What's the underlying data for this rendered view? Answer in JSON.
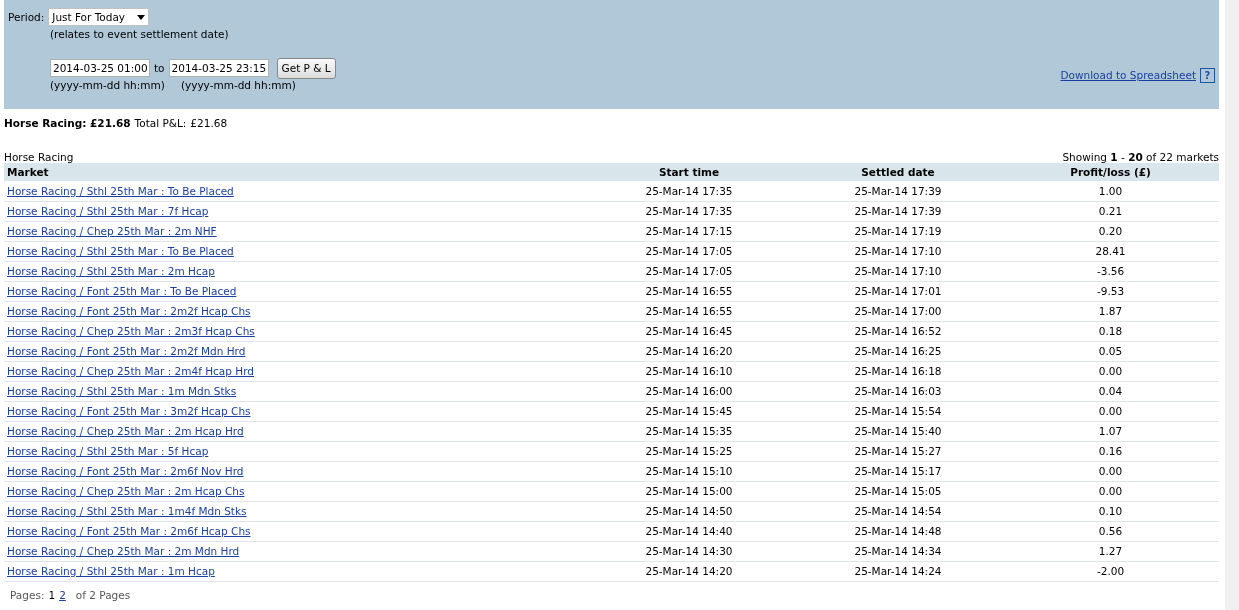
{
  "filter": {
    "period_label": "Period:",
    "period_value": "Just For Today",
    "period_note": "(relates to event settlement date)",
    "from_value": "2014-03-25 01:00",
    "to_label": "to",
    "to_value": "2014-03-25 23:15",
    "from_hint": "(yyyy-mm-dd hh:mm)",
    "to_hint": "(yyyy-mm-dd hh:mm)",
    "button": "Get P & L",
    "download_link": "Download to Spreadsheet",
    "help": "?"
  },
  "summary": {
    "sport_total": "**Horse Racing: £21.68**",
    "total_label": "Total P&L:",
    "total_value": "£21.68"
  },
  "table": {
    "caption": "Horse Racing",
    "showing": "Showing **1** - **20** of 22 markets",
    "columns": [
      "Market",
      "Start time",
      "Settled date",
      "Profit/loss (£)"
    ],
    "rows": [
      [
        "Horse Racing / Sthl 25th Mar : To Be Placed",
        "25-Mar-14 17:35",
        "25-Mar-14 17:39",
        "1.00"
      ],
      [
        "Horse Racing / Sthl 25th Mar : 7f Hcap",
        "25-Mar-14 17:35",
        "25-Mar-14 17:39",
        "0.21"
      ],
      [
        "Horse Racing / Chep 25th Mar : 2m NHF",
        "25-Mar-14 17:15",
        "25-Mar-14 17:19",
        "0.20"
      ],
      [
        "Horse Racing / Sthl 25th Mar : To Be Placed",
        "25-Mar-14 17:05",
        "25-Mar-14 17:10",
        "28.41"
      ],
      [
        "Horse Racing / Sthl 25th Mar : 2m Hcap",
        "25-Mar-14 17:05",
        "25-Mar-14 17:10",
        "-3.56"
      ],
      [
        "Horse Racing / Font 25th Mar : To Be Placed",
        "25-Mar-14 16:55",
        "25-Mar-14 17:01",
        "-9.53"
      ],
      [
        "Horse Racing / Font 25th Mar : 2m2f Hcap Chs",
        "25-Mar-14 16:55",
        "25-Mar-14 17:00",
        "1.87"
      ],
      [
        "Horse Racing / Chep 25th Mar : 2m3f Hcap Chs",
        "25-Mar-14 16:45",
        "25-Mar-14 16:52",
        "0.18"
      ],
      [
        "Horse Racing / Font 25th Mar : 2m2f Mdn Hrd",
        "25-Mar-14 16:20",
        "25-Mar-14 16:25",
        "0.05"
      ],
      [
        "Horse Racing / Chep 25th Mar : 2m4f Hcap Hrd",
        "25-Mar-14 16:10",
        "25-Mar-14 16:18",
        "0.00"
      ],
      [
        "Horse Racing / Sthl 25th Mar : 1m Mdn Stks",
        "25-Mar-14 16:00",
        "25-Mar-14 16:03",
        "0.04"
      ],
      [
        "Horse Racing / Font 25th Mar : 3m2f Hcap Chs",
        "25-Mar-14 15:45",
        "25-Mar-14 15:54",
        "0.00"
      ],
      [
        "Horse Racing / Chep 25th Mar : 2m Hcap Hrd",
        "25-Mar-14 15:35",
        "25-Mar-14 15:40",
        "1.07"
      ],
      [
        "Horse Racing / Sthl 25th Mar : 5f Hcap",
        "25-Mar-14 15:25",
        "25-Mar-14 15:27",
        "0.16"
      ],
      [
        "Horse Racing / Font 25th Mar : 2m6f Nov Hrd",
        "25-Mar-14 15:10",
        "25-Mar-14 15:17",
        "0.00"
      ],
      [
        "Horse Racing / Chep 25th Mar : 2m Hcap Chs",
        "25-Mar-14 15:00",
        "25-Mar-14 15:05",
        "0.00"
      ],
      [
        "Horse Racing / Sthl 25th Mar : 1m4f Mdn Stks",
        "25-Mar-14 14:50",
        "25-Mar-14 14:54",
        "0.10"
      ],
      [
        "Horse Racing / Font 25th Mar : 2m6f Hcap Chs",
        "25-Mar-14 14:40",
        "25-Mar-14 14:48",
        "0.56"
      ],
      [
        "Horse Racing / Chep 25th Mar : 2m Mdn Hrd",
        "25-Mar-14 14:30",
        "25-Mar-14 14:34",
        "1.27"
      ],
      [
        "Horse Racing / Sthl 25th Mar : 1m Hcap",
        "25-Mar-14 14:20",
        "25-Mar-14 14:24",
        "-2.00"
      ]
    ]
  },
  "pagination": {
    "label": "Pages:",
    "pages": [
      {
        "label": "1",
        "selected": true
      },
      {
        "label": "2",
        "selected": false
      }
    ],
    "total": "of 2 Pages"
  }
}
